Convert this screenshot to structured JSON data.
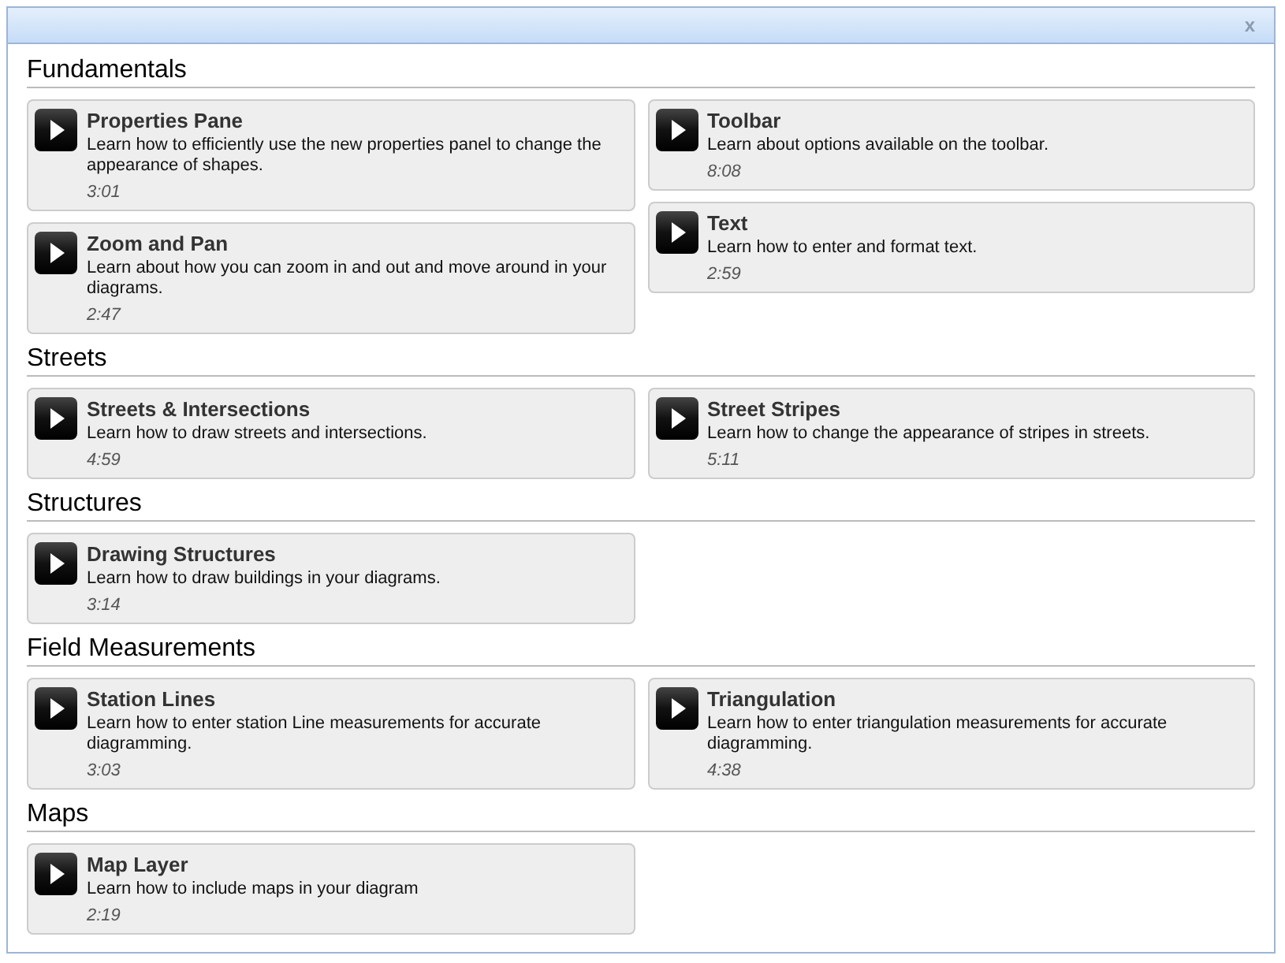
{
  "window": {
    "close": "x"
  },
  "sections": [
    {
      "title": "Fundamentals",
      "columns": [
        [
          {
            "title": "Properties Pane",
            "description": "Learn how to efficiently use the new properties panel to change the appearance of shapes.",
            "duration": "3:01"
          },
          {
            "title": "Zoom and Pan",
            "description": "Learn about how you can zoom in and out and move around in your diagrams.",
            "duration": "2:47"
          }
        ],
        [
          {
            "title": "Toolbar",
            "description": "Learn about options available on the toolbar.",
            "duration": "8:08"
          },
          {
            "title": "Text",
            "description": "Learn how to enter and format text.",
            "duration": "2:59"
          }
        ]
      ]
    },
    {
      "title": "Streets",
      "columns": [
        [
          {
            "title": "Streets & Intersections",
            "description": "Learn how to draw streets and intersections.",
            "duration": "4:59"
          }
        ],
        [
          {
            "title": "Street Stripes",
            "description": "Learn how to change the appearance of stripes in streets.",
            "duration": "5:11"
          }
        ]
      ]
    },
    {
      "title": "Structures",
      "columns": [
        [
          {
            "title": "Drawing Structures",
            "description": "Learn how to draw buildings in your diagrams.",
            "duration": "3:14"
          }
        ]
      ]
    },
    {
      "title": "Field Measurements",
      "columns": [
        [
          {
            "title": "Station Lines",
            "description": "Learn how to enter station Line measurements for accurate diagramming.",
            "duration": "3:03"
          }
        ],
        [
          {
            "title": "Triangulation",
            "description": "Learn how to enter triangulation measurements for accurate diagramming.",
            "duration": "4:38"
          }
        ]
      ]
    },
    {
      "title": "Maps",
      "columns": [
        [
          {
            "title": "Map Layer",
            "description": "Learn how to include maps in your diagram",
            "duration": "2:19"
          }
        ]
      ]
    }
  ]
}
